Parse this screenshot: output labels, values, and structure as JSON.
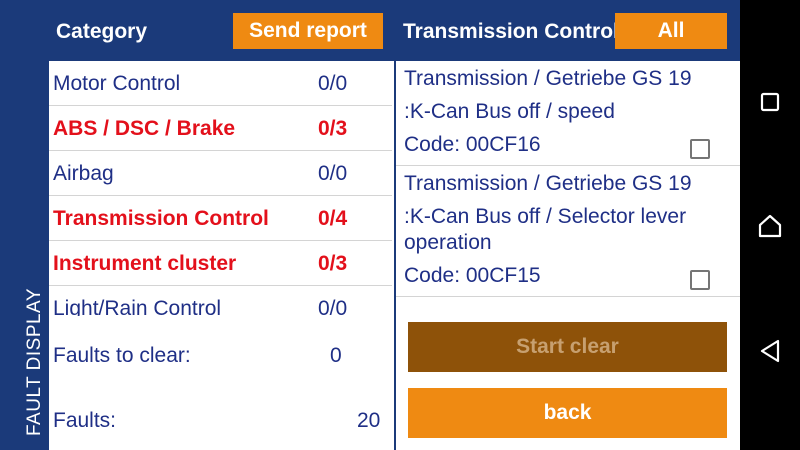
{
  "app": {
    "side_title": "FAULT DISPLAY"
  },
  "left_panel": {
    "header_title": "Category",
    "send_report_label": "Send report",
    "categories": [
      {
        "name": "Motor Control",
        "count": "0/0",
        "alert": false
      },
      {
        "name": "ABS / DSC / Brake",
        "count": "0/3",
        "alert": true
      },
      {
        "name": "Airbag",
        "count": "0/0",
        "alert": false
      },
      {
        "name": "Transmission Control",
        "count": "0/4",
        "alert": true
      },
      {
        "name": "Instrument cluster",
        "count": "0/3",
        "alert": true
      },
      {
        "name": "Light/Rain Control",
        "count": "0/0",
        "alert": false
      }
    ],
    "faults_to_clear_label": "Faults to clear:",
    "faults_to_clear_value": "0",
    "faults_label": "Faults:",
    "faults_value": "20"
  },
  "right_panel": {
    "header_title": "Transmission Control",
    "all_label": "All",
    "faults": [
      {
        "title": "Transmission / Getriebe GS 19",
        "description": ":K-Can Bus off / speed",
        "code": "Code:  00CF16",
        "checked": false
      },
      {
        "title": "Transmission / Getriebe GS 19",
        "description": ":K-Can Bus off / Selector lever operation",
        "code": "Code:  00CF15",
        "checked": false
      }
    ],
    "start_clear_label": "Start clear",
    "back_label": "back"
  },
  "colors": {
    "header_bg": "#1b3a7a",
    "accent_orange": "#ef8a12",
    "disabled_button": "#8e5209",
    "alert_red": "#e3101b",
    "text_blue": "#1f2f86"
  },
  "nav_bar": {
    "icons": [
      "recent-apps-icon",
      "home-icon",
      "back-nav-icon"
    ]
  }
}
